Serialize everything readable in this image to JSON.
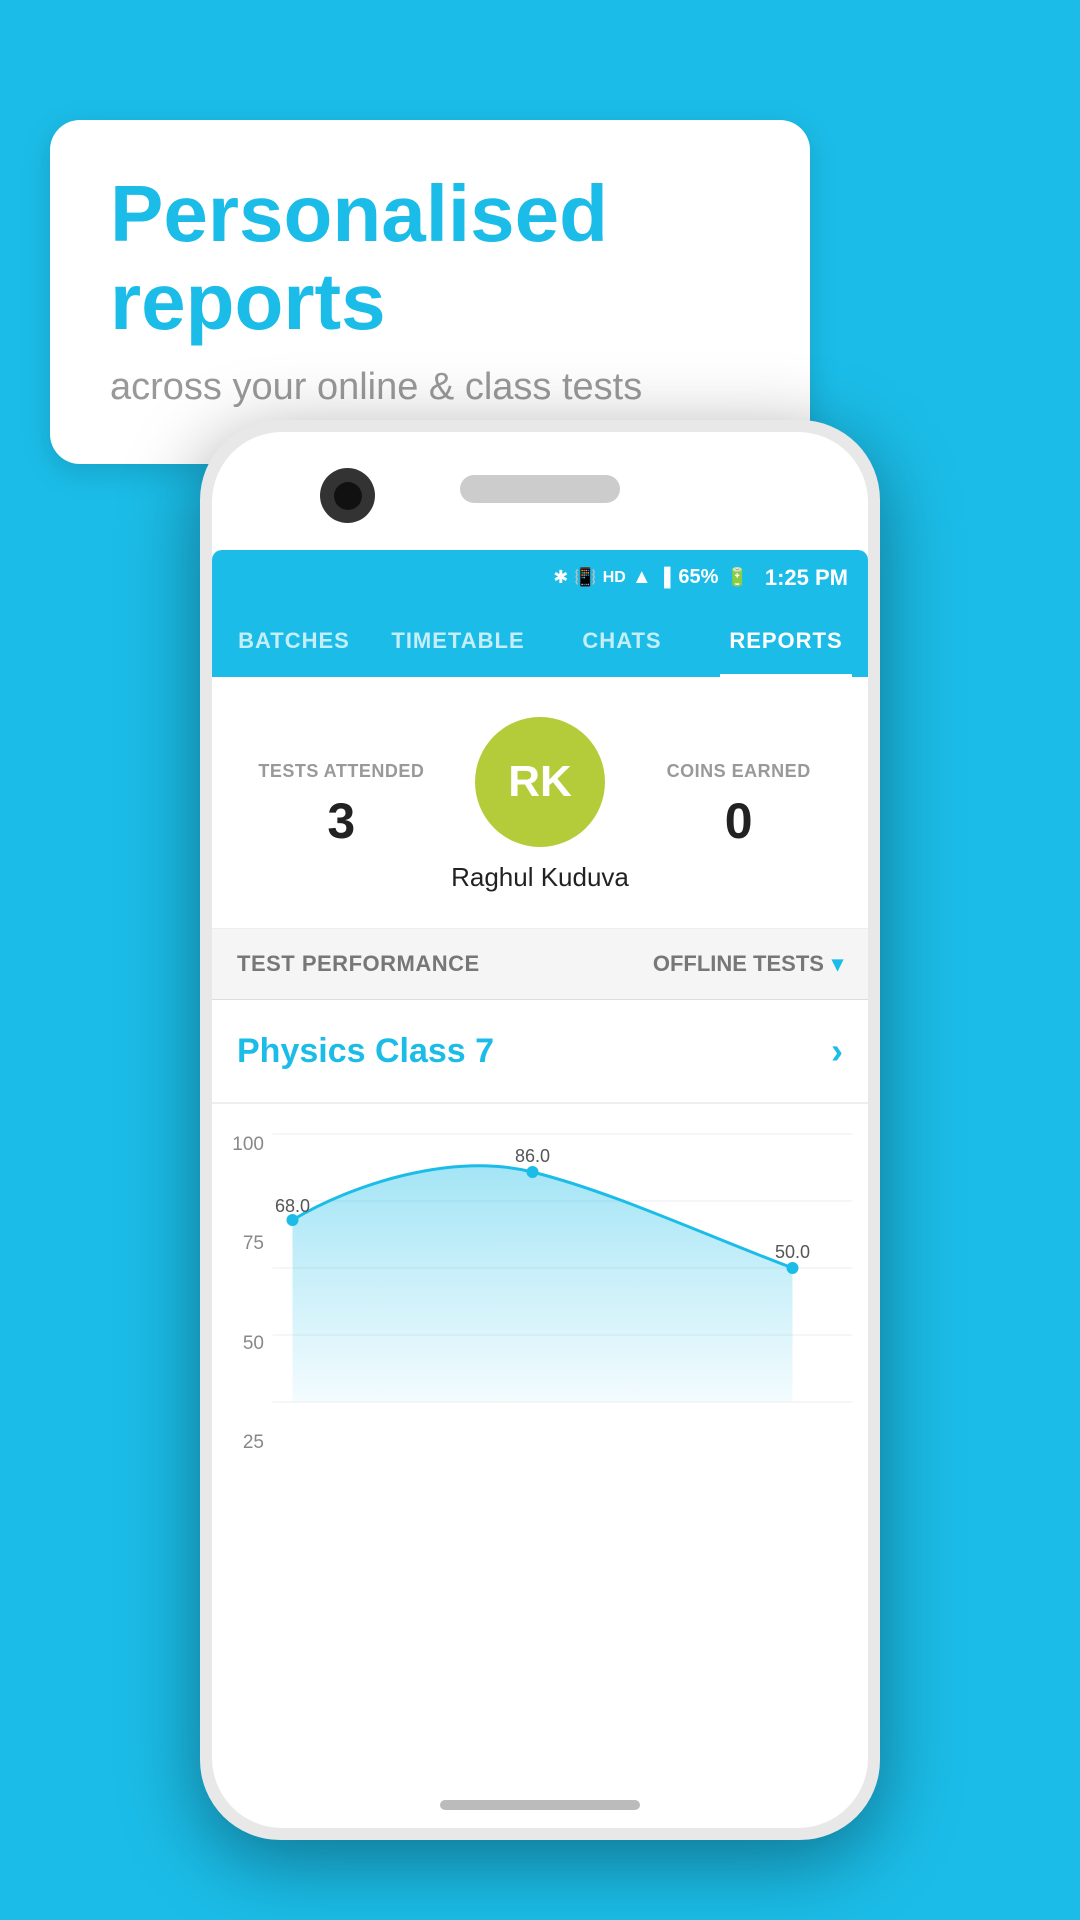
{
  "background_color": "#1BBDE8",
  "bubble": {
    "title": "Personalised reports",
    "subtitle": "across your online & class tests"
  },
  "status_bar": {
    "battery": "65%",
    "time": "1:25 PM"
  },
  "nav": {
    "tabs": [
      {
        "id": "batches",
        "label": "BATCHES",
        "active": false
      },
      {
        "id": "timetable",
        "label": "TIMETABLE",
        "active": false
      },
      {
        "id": "chats",
        "label": "CHATS",
        "active": false
      },
      {
        "id": "reports",
        "label": "REPORTS",
        "active": true
      }
    ]
  },
  "profile": {
    "tests_attended_label": "TESTS ATTENDED",
    "tests_attended_value": "3",
    "coins_earned_label": "COINS EARNED",
    "coins_earned_value": "0",
    "avatar_initials": "RK",
    "user_name": "Raghul Kuduva"
  },
  "filter": {
    "performance_label": "TEST PERFORMANCE",
    "dropdown_label": "OFFLINE TESTS"
  },
  "class_item": {
    "name": "Physics Class 7"
  },
  "chart": {
    "y_labels": [
      "100",
      "75",
      "50",
      "25"
    ],
    "data_points": [
      {
        "label": "",
        "value": 68.0,
        "x_pct": 0
      },
      {
        "label": "86.0",
        "value": 86.0,
        "x_pct": 45
      },
      {
        "label": "50.0",
        "value": 50.0,
        "x_pct": 90
      }
    ]
  }
}
